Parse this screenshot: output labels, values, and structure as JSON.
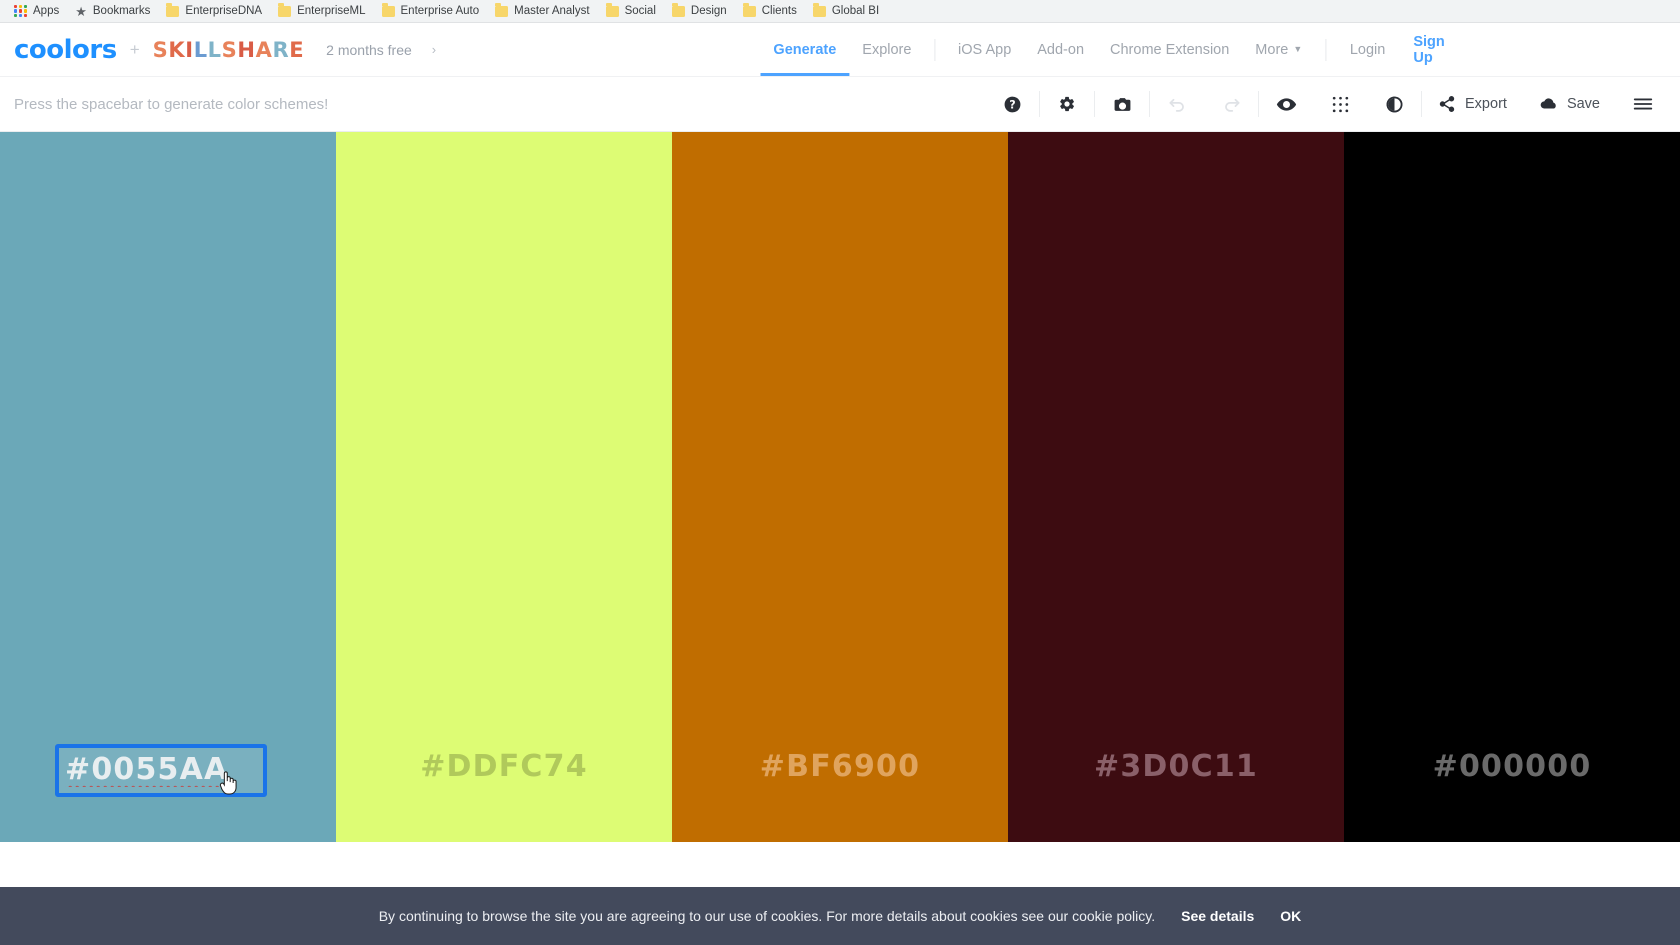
{
  "browser": {
    "apps_label": "Apps",
    "star_icon": "star-icon",
    "apps_icon": "apps-grid-icon",
    "bookmarks": [
      {
        "label": "Bookmarks",
        "icon": "star-icon"
      },
      {
        "label": "EnterpriseDNA",
        "icon": "folder-icon"
      },
      {
        "label": "EnterpriseML",
        "icon": "folder-icon"
      },
      {
        "label": "Enterprise Auto",
        "icon": "folder-icon"
      },
      {
        "label": "Master Analyst",
        "icon": "folder-icon"
      },
      {
        "label": "Social",
        "icon": "folder-icon"
      },
      {
        "label": "Design",
        "icon": "folder-icon"
      },
      {
        "label": "Clients",
        "icon": "folder-icon"
      },
      {
        "label": "Global BI",
        "icon": "folder-icon"
      }
    ]
  },
  "header": {
    "logo": "coolors",
    "logo_color": "#1e90ff",
    "plus": "+",
    "partner_logo": "SKILLSHARE",
    "partner_letters": [
      {
        "c": "S",
        "color": "#e8825a"
      },
      {
        "c": "K",
        "color": "#e06a4a"
      },
      {
        "c": "I",
        "color": "#d95c46"
      },
      {
        "c": "L",
        "color": "#6b9bd1"
      },
      {
        "c": "L",
        "color": "#7fb3c8"
      },
      {
        "c": "S",
        "color": "#e8825a"
      },
      {
        "c": "H",
        "color": "#d95c46"
      },
      {
        "c": "A",
        "color": "#e8825a"
      },
      {
        "c": "R",
        "color": "#7fb3c8"
      },
      {
        "c": "E",
        "color": "#e06a4a"
      }
    ],
    "promo": "2 months free",
    "promo_arrow": "›",
    "nav": [
      {
        "label": "Generate",
        "active": true
      },
      {
        "label": "Explore",
        "active": false
      },
      {
        "label": "iOS App",
        "active": false
      },
      {
        "label": "Add-on",
        "active": false
      },
      {
        "label": "Chrome Extension",
        "active": false
      },
      {
        "label": "More",
        "active": false,
        "has_chevron": true
      }
    ],
    "login": "Login",
    "signup": "Sign Up",
    "active_color": "#4da3ff"
  },
  "toolbar": {
    "hint": "Press the spacebar to generate color schemes!",
    "icons": [
      {
        "name": "help-icon",
        "disabled": false
      },
      {
        "name": "gear-icon",
        "disabled": false
      },
      {
        "name": "camera-icon",
        "disabled": false
      },
      {
        "name": "undo-icon",
        "disabled": true
      },
      {
        "name": "redo-icon",
        "disabled": true
      },
      {
        "name": "eye-icon",
        "disabled": false
      },
      {
        "name": "grid-dots-icon",
        "disabled": false
      },
      {
        "name": "contrast-icon",
        "disabled": false
      }
    ],
    "export_label": "Export",
    "save_label": "Save",
    "menu_icon": "hamburger-menu-icon"
  },
  "palette": {
    "swatches": [
      {
        "hex": "#0055AA",
        "display_color": "#6ba8b8",
        "text_color": "#e8eef0",
        "editing": true
      },
      {
        "hex": "#DDFC74",
        "display_color": "#ddfc74",
        "text_color": "#b0c95b",
        "editing": false
      },
      {
        "hex": "#BF6900",
        "display_color": "#c06d00",
        "text_color": "#e0a45e",
        "editing": false
      },
      {
        "hex": "#3D0C11",
        "display_color": "#3d0c11",
        "text_color": "#8a6069",
        "editing": false
      },
      {
        "hex": "#000000",
        "display_color": "#000000",
        "text_color": "#6a6a6a",
        "editing": false
      }
    ]
  },
  "cookie": {
    "text": "By continuing to browse the site you are agreeing to our use of cookies. For more details about cookies see our cookie policy.",
    "details_label": "See details",
    "ok_label": "OK",
    "bg_color": "#434a5c"
  }
}
